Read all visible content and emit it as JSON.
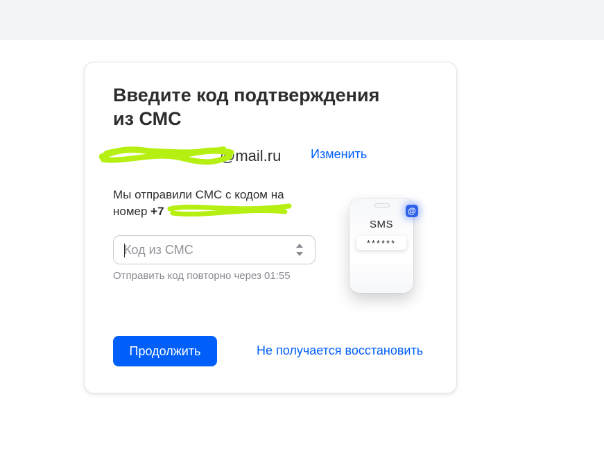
{
  "form": {
    "title_line1": "Введите код подтверждения",
    "title_line2": "из СМС",
    "email_visible_suffix": "@mail.ru",
    "change_link": "Изменить",
    "sent_line1": "Мы отправили СМС с кодом на",
    "sent_line2_prefix": "номер ",
    "phone_prefix": "+7",
    "code_input": {
      "value": "",
      "placeholder": "Код из СМС"
    },
    "resend_text": "Отправить код повторно через 01:55",
    "continue_button": "Продолжить",
    "recover_link": "Не получается восстановить"
  },
  "illustration": {
    "sms_label": "SMS",
    "code_mask": "******",
    "badge_symbol": "@",
    "badge_icon": "at-sign-icon"
  },
  "colors": {
    "accent": "#005ff9",
    "redaction": "#b6ef12",
    "text": "#2c2d2e",
    "muted": "#87898f"
  },
  "redactions": {
    "email_local_part": "redacted",
    "phone_number": "redacted"
  }
}
